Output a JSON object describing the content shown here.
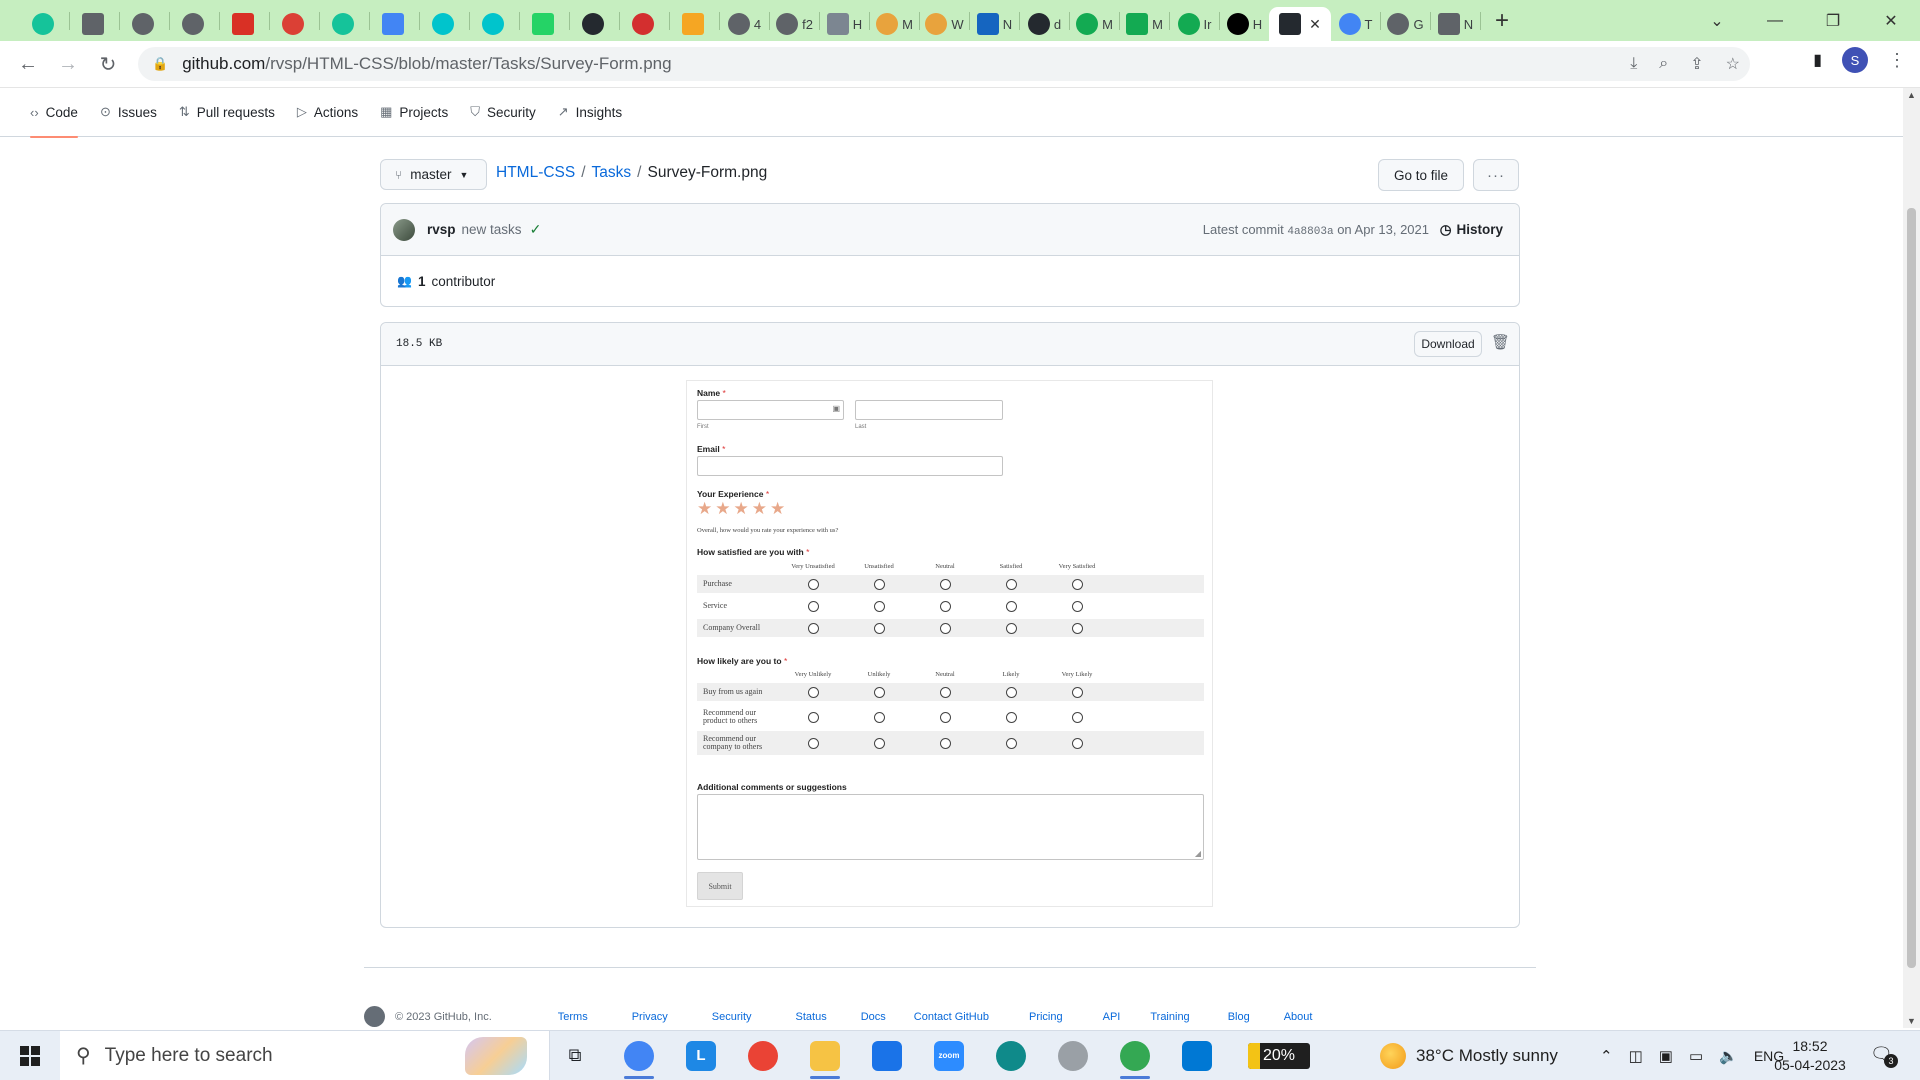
{
  "browser": {
    "tabs": [
      {
        "label": "",
        "icon": "grammarly-icon",
        "color": "#15c39a"
      },
      {
        "label": "",
        "icon": "classroom-icon",
        "color": "#5f6368"
      },
      {
        "label": "",
        "icon": "classroom-icon",
        "color": "#5f6368"
      },
      {
        "label": "",
        "icon": "classroom-icon",
        "color": "#5f6368"
      },
      {
        "label": "",
        "icon": "gmail-icon",
        "color": "#d93025"
      },
      {
        "label": "",
        "icon": "todoist-icon",
        "color": "#db4035"
      },
      {
        "label": "",
        "icon": "grammarly-icon",
        "color": "#15c39a"
      },
      {
        "label": "",
        "icon": "docs-icon",
        "color": "#4285f4"
      },
      {
        "label": "",
        "icon": "canva-icon",
        "color": "#00c4cc"
      },
      {
        "label": "",
        "icon": "canva-icon",
        "color": "#00c4cc"
      },
      {
        "label": "",
        "icon": "whatsapp-icon",
        "color": "#25d366"
      },
      {
        "label": "",
        "icon": "github-icon",
        "color": "#24292f"
      },
      {
        "label": "",
        "icon": "hub-icon",
        "color": "#d32f2f"
      },
      {
        "label": "",
        "icon": "pen-icon",
        "color": "#f5a623"
      },
      {
        "label": "4",
        "icon": "globe-icon",
        "color": "#5f6368"
      },
      {
        "label": "f2",
        "icon": "globe-icon",
        "color": "#5f6368"
      },
      {
        "label": "H",
        "icon": "notion-icon",
        "color": "#7c8691"
      },
      {
        "label": "M",
        "icon": "folder-icon",
        "color": "#e8a33d"
      },
      {
        "label": "W",
        "icon": "folder-icon",
        "color": "#e8a33d"
      },
      {
        "label": "N",
        "icon": "cursor-icon",
        "color": "#1565c0"
      },
      {
        "label": "d",
        "icon": "github-icon",
        "color": "#24292f"
      },
      {
        "label": "M",
        "icon": "mongodb-icon",
        "color": "#13aa52"
      },
      {
        "label": "M",
        "icon": "mongodb-icon",
        "color": "#13aa52"
      },
      {
        "label": "Ir",
        "icon": "mongodb-icon",
        "color": "#13aa52"
      },
      {
        "label": "H",
        "icon": "medium-icon",
        "color": "#000000"
      },
      {
        "label": "",
        "icon": "github-icon",
        "color": "#24292f",
        "active": true
      },
      {
        "label": "T",
        "icon": "google-icon",
        "color": "#4285f4"
      },
      {
        "label": "G",
        "icon": "globe-icon",
        "color": "#5f6368"
      },
      {
        "label": "N",
        "icon": "chrome-icon",
        "color": "#5f6368"
      }
    ],
    "url_host": "github.com",
    "url_path": "/rvsp/HTML-CSS/blob/master/Tasks/Survey-Form.png",
    "profile_initial": "S"
  },
  "repo_nav": [
    {
      "label": "Code",
      "icon": "code-icon",
      "selected": true
    },
    {
      "label": "Issues",
      "icon": "issue-icon"
    },
    {
      "label": "Pull requests",
      "icon": "pull-request-icon"
    },
    {
      "label": "Actions",
      "icon": "play-icon"
    },
    {
      "label": "Projects",
      "icon": "table-icon"
    },
    {
      "label": "Security",
      "icon": "shield-icon"
    },
    {
      "label": "Insights",
      "icon": "graph-icon"
    }
  ],
  "file_nav": {
    "branch": "master",
    "breadcrumb": [
      "HTML-CSS",
      "Tasks"
    ],
    "filename": "Survey-Form.png",
    "go_to_file": "Go to file",
    "more": "···"
  },
  "commit": {
    "author": "rvsp",
    "message": "new tasks",
    "latest_label": "Latest commit",
    "sha": "4a8803a",
    "date": "on Apr 13, 2021",
    "history": "History",
    "contributors_count": "1",
    "contributors_label": "contributor"
  },
  "file": {
    "size": "18.5 KB",
    "download": "Download"
  },
  "survey": {
    "name_label": "Name",
    "first": "First",
    "last": "Last",
    "email_label": "Email",
    "experience_label": "Your Experience",
    "stars": 5,
    "question": "Overall, how would you rate your experience with us?",
    "satisfied_label": "How satisfied are you with",
    "satisfied_columns": [
      "Very Unsatisfied",
      "Unsatisfied",
      "Neutral",
      "Satisfied",
      "Very Satisfied"
    ],
    "satisfied_rows": [
      "Purchase",
      "Service",
      "Company Overall"
    ],
    "likely_label": "How likely are you to",
    "likely_columns": [
      "Very Unlikely",
      "Unlikely",
      "Neutral",
      "Likely",
      "Very Likely"
    ],
    "likely_rows": [
      "Buy from us again",
      "Recommend our product to others",
      "Recommend our company to others"
    ],
    "comments_label": "Additional comments or suggestions",
    "submit": "Submit",
    "required_mark": "*"
  },
  "footer": {
    "copyright": "© 2023 GitHub, Inc.",
    "links": [
      "Terms",
      "Privacy",
      "Security",
      "Status",
      "Docs",
      "Contact GitHub",
      "Pricing",
      "API",
      "Training",
      "Blog",
      "About"
    ]
  },
  "taskbar": {
    "search_placeholder": "Type here to search",
    "apps": [
      {
        "icon": "chrome-profile-icon",
        "color": "#4285f4",
        "open": true
      },
      {
        "icon": "l-app-icon",
        "color": "#1e88e5",
        "glyph": "L"
      },
      {
        "icon": "chrome-icon",
        "color": "#ea4335"
      },
      {
        "icon": "file-explorer-icon",
        "color": "#f6c344",
        "open": true
      },
      {
        "icon": "mail-icon",
        "color": "#1a73e8"
      },
      {
        "icon": "zoom-icon",
        "color": "#2d8cff",
        "glyph": "zoom"
      },
      {
        "icon": "edge-icon",
        "color": "#0f8a8a"
      },
      {
        "icon": "cortana-icon",
        "color": "#9aa0a6"
      },
      {
        "icon": "chrome-profile-icon",
        "color": "#34a853",
        "open": true
      },
      {
        "icon": "vscode-icon",
        "color": "#0078d4"
      }
    ],
    "battery_percent": 20,
    "battery": "20%",
    "weather": "38°C  Mostly sunny",
    "language": "ENG",
    "time": "18:52",
    "date": "05-04-2023",
    "notifications": "3"
  }
}
